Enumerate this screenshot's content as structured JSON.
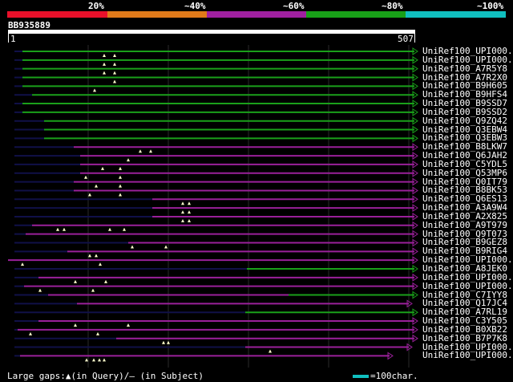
{
  "legend": {
    "labels": [
      "20%",
      "~40%",
      "~60%",
      "~80%",
      "~100%"
    ],
    "colors": [
      "#e8102a",
      "#e07a1a",
      "#a020a0",
      "#18a018",
      "#10bfbf"
    ]
  },
  "query": {
    "name": "BB935889",
    "start": "1",
    "end": "507",
    "length": 507
  },
  "colors": {
    "green": "#1aa01a",
    "purple": "#9a209a",
    "dark": "#101048",
    "marker": "#ffffcc",
    "grid": "#2a2a2a"
  },
  "hits": [
    {
      "name": "UniRef100_UPI000..",
      "color": "green",
      "ext": [
        8,
        18
      ],
      "al": [
        [
          18,
          507
        ]
      ],
      "mk": [
        120,
        133
      ]
    },
    {
      "name": "UniRef100_UPI000..",
      "color": "green",
      "ext": [
        8,
        18
      ],
      "al": [
        [
          18,
          507
        ]
      ],
      "mk": [
        120,
        133
      ]
    },
    {
      "name": "UniRef100_A7R5Y8",
      "color": "green",
      "ext": [
        8,
        18
      ],
      "al": [
        [
          18,
          507
        ]
      ],
      "mk": [
        120,
        133
      ]
    },
    {
      "name": "UniRef100_A7R2X0",
      "color": "green",
      "ext": [
        8,
        18
      ],
      "al": [
        [
          18,
          507
        ]
      ],
      "mk": [
        133
      ]
    },
    {
      "name": "UniRef100_B9H605",
      "color": "green",
      "ext": [
        8,
        18
      ],
      "al": [
        [
          18,
          507
        ]
      ],
      "mk": [
        108
      ]
    },
    {
      "name": "UniRef100_B9HFS4",
      "color": "green",
      "ext": [
        8,
        30
      ],
      "al": [
        [
          30,
          507
        ]
      ],
      "mk": []
    },
    {
      "name": "UniRef100_B9SSD7",
      "color": "green",
      "ext": [
        8,
        18
      ],
      "al": [
        [
          18,
          507
        ]
      ],
      "mk": []
    },
    {
      "name": "UniRef100_B9SSD2",
      "color": "green",
      "ext": [
        8,
        18
      ],
      "al": [
        [
          18,
          507
        ]
      ],
      "mk": []
    },
    {
      "name": "UniRef100_Q9ZQ42",
      "color": "green",
      "ext": [
        8,
        45
      ],
      "al": [
        [
          45,
          507
        ]
      ],
      "mk": []
    },
    {
      "name": "UniRef100_Q3EBW4",
      "color": "green",
      "ext": [
        8,
        45
      ],
      "al": [
        [
          45,
          507
        ]
      ],
      "mk": []
    },
    {
      "name": "UniRef100_Q3EBW3",
      "color": "green",
      "ext": [
        8,
        45
      ],
      "al": [
        [
          45,
          507
        ]
      ],
      "mk": []
    },
    {
      "name": "UniRef100_B8LKW7",
      "color": "purple",
      "ext": [
        8,
        82
      ],
      "al": [
        [
          82,
          507
        ]
      ],
      "mk": [
        165,
        178
      ]
    },
    {
      "name": "UniRef100_Q6JAH2",
      "color": "purple",
      "ext": [
        8,
        90
      ],
      "al": [
        [
          90,
          507
        ]
      ],
      "mk": [
        150
      ]
    },
    {
      "name": "UniRef100_C5YDL5",
      "color": "purple",
      "ext": [
        8,
        90
      ],
      "al": [
        [
          90,
          507
        ]
      ],
      "mk": [
        118,
        140
      ]
    },
    {
      "name": "UniRef100_Q53MP6",
      "color": "purple",
      "ext": [
        8,
        90
      ],
      "al": [
        [
          90,
          507
        ]
      ],
      "mk": [
        97,
        140
      ]
    },
    {
      "name": "UniRef100_Q0IT79",
      "color": "purple",
      "ext": [
        8,
        82
      ],
      "al": [
        [
          82,
          507
        ]
      ],
      "mk": [
        110,
        140
      ]
    },
    {
      "name": "UniRef100_B8BK53",
      "color": "purple",
      "ext": [
        8,
        82
      ],
      "al": [
        [
          82,
          507
        ]
      ],
      "mk": [
        102,
        140
      ]
    },
    {
      "name": "UniRef100_Q6ES13",
      "color": "purple",
      "ext": [
        8,
        180
      ],
      "al": [
        [
          180,
          507
        ]
      ],
      "mk": [
        218,
        226
      ]
    },
    {
      "name": "UniRef100_A3A9W4",
      "color": "purple",
      "ext": [
        8,
        180
      ],
      "al": [
        [
          180,
          507
        ]
      ],
      "mk": [
        218,
        226
      ]
    },
    {
      "name": "UniRef100_A2X825",
      "color": "purple",
      "ext": [
        8,
        180
      ],
      "al": [
        [
          180,
          507
        ]
      ],
      "mk": [
        218,
        226
      ]
    },
    {
      "name": "UniRef100_A9T979",
      "color": "purple",
      "ext": [
        8,
        30
      ],
      "al": [
        [
          30,
          507
        ]
      ],
      "mk": [
        62,
        70,
        127,
        145
      ]
    },
    {
      "name": "UniRef100_Q9T073",
      "color": "purple",
      "ext": [
        8,
        22
      ],
      "al": [
        [
          22,
          507
        ]
      ],
      "mk": []
    },
    {
      "name": "UniRef100_B9GEZ8",
      "color": "purple",
      "ext": [
        8,
        150
      ],
      "al": [
        [
          150,
          507
        ]
      ],
      "mk": [
        155,
        197
      ]
    },
    {
      "name": "UniRef100_B9RIG4",
      "color": "purple",
      "ext": [
        8,
        74
      ],
      "al": [
        [
          74,
          507
        ]
      ],
      "mk": [
        102,
        110
      ]
    },
    {
      "name": "UniRef100_UPI000..",
      "color": "purple",
      "ext": [],
      "al": [
        [
          0,
          507
        ]
      ],
      "mk": [
        18,
        115
      ]
    },
    {
      "name": "UniRef100_A8JEK0",
      "color": "green",
      "ext": [
        8,
        298
      ],
      "al": [
        [
          298,
          507
        ]
      ],
      "mk": []
    },
    {
      "name": "UniRef100_UPI000..",
      "color": "purple",
      "ext": [
        8,
        38
      ],
      "al": [
        [
          38,
          507
        ]
      ],
      "mk": [
        84,
        122
      ]
    },
    {
      "name": "UniRef100_UPI000..",
      "color": "purple",
      "ext": [
        8,
        20
      ],
      "al": [
        [
          20,
          507
        ]
      ],
      "mk": [
        40,
        106
      ]
    },
    {
      "name": "UniRef100_C7IYY8",
      "color": "purple",
      "ext": [
        8,
        50
      ],
      "al": [
        [
          50,
          350
        ]
      ],
      "al2": {
        "color": "green",
        "range": [
          350,
          507
        ]
      },
      "mk": []
    },
    {
      "name": "UniRef100_Q17JC4",
      "color": "purple",
      "ext": [
        8,
        86
      ],
      "al": [
        [
          86,
          500
        ]
      ],
      "mk": []
    },
    {
      "name": "UniRef100_A7RL19",
      "color": "green",
      "ext": [
        8,
        296
      ],
      "al": [
        [
          296,
          507
        ]
      ],
      "mk": []
    },
    {
      "name": "UniRef100_C3Y505",
      "color": "purple",
      "ext": [
        8,
        38
      ],
      "al": [
        [
          38,
          507
        ]
      ],
      "mk": [
        84,
        150
      ]
    },
    {
      "name": "UniRef100_B0XB22",
      "color": "purple",
      "ext": [
        8,
        12
      ],
      "al": [
        [
          12,
          507
        ]
      ],
      "mk": [
        28,
        112
      ]
    },
    {
      "name": "UniRef100_B7P7K8",
      "color": "purple",
      "ext": [
        8,
        135
      ],
      "al": [
        [
          135,
          507
        ]
      ],
      "mk": [
        194,
        200
      ]
    },
    {
      "name": "UniRef100_UPI000..",
      "color": "purple",
      "ext": [
        8,
        296
      ],
      "al": [
        [
          296,
          500
        ]
      ],
      "mk": [
        327
      ]
    },
    {
      "name": "UniRef100_UPI000..",
      "color": "purple",
      "ext": [
        8,
        15
      ],
      "al": [
        [
          15,
          476
        ]
      ],
      "mk": [
        98,
        107,
        114,
        120
      ]
    }
  ],
  "footer": {
    "text": "Large gaps:▲(in Query)/– (in Subject)"
  },
  "scale": {
    "text": "=100char."
  }
}
